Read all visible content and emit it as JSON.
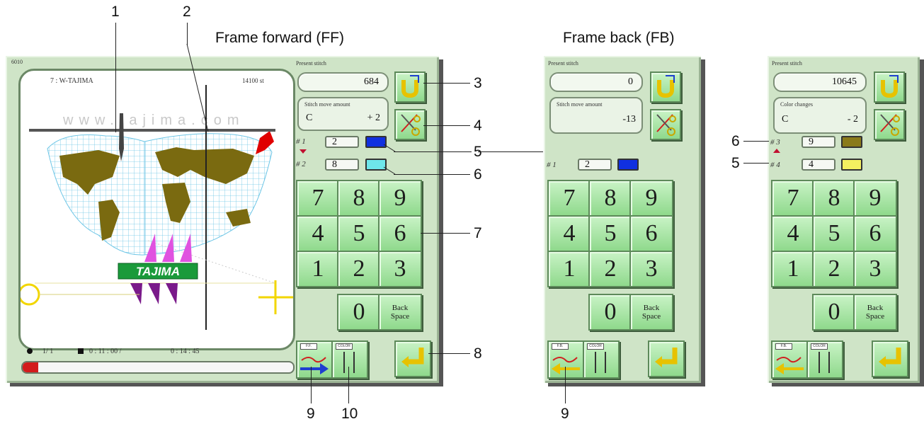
{
  "captions": {
    "frame_forward": "Frame forward (FF)",
    "frame_back": "Frame back (FB)"
  },
  "callouts": {
    "n1": "1",
    "n2": "2",
    "n3": "3",
    "n4": "4",
    "n5": "5",
    "n6": "6",
    "n7": "7",
    "n8": "8",
    "n9": "9",
    "n10": "10",
    "n5b": "5",
    "n9b": "9",
    "n6c": "6",
    "n5c": "5"
  },
  "ff_panel": {
    "corner_code": "6010",
    "design_name": "7 : W-TAJIMA",
    "design_stitches": "14100 st",
    "watermark": "www.tajima.com",
    "logo_text": "TAJIMA",
    "status": {
      "counter": "1/ 1",
      "elapsed": "0 : 11 : 00 /",
      "total": "0 : 14 : 45"
    },
    "present_stitch_label": "Present stitch",
    "present_stitch_value": "684",
    "move_label": "Stitch move amount",
    "move_mode": "C",
    "move_value": "+ 2",
    "needle_rows": [
      {
        "label": "# 1",
        "value": "2",
        "color": "#1030e0"
      },
      {
        "label": "# 2",
        "value": "8",
        "color": "#6ee6ea"
      }
    ]
  },
  "fb_panel": {
    "present_stitch_label": "Present stitch",
    "present_stitch_value": "0",
    "move_label": "Stitch move amount",
    "move_value": "-13",
    "needle_rows": [
      {
        "label": "# 1",
        "value": "2",
        "color": "#1030e0"
      }
    ]
  },
  "cb_panel": {
    "present_stitch_label": "Present stitch",
    "present_stitch_value": "10645",
    "move_label": "Color changes",
    "move_mode": "C",
    "move_value": "- 2",
    "needle_rows": [
      {
        "label": "# 3",
        "value": "9",
        "color": "#8a7a1a"
      },
      {
        "label": "# 4",
        "value": "4",
        "color": "#f4f060"
      }
    ]
  },
  "keypad": {
    "keys": [
      "7",
      "8",
      "9",
      "4",
      "5",
      "6",
      "1",
      "2",
      "3",
      "0"
    ],
    "backspace_line1": "Back",
    "backspace_line2": "Space"
  },
  "bottom_buttons": {
    "ff_tab": "F.F.",
    "fb_tab": "F.B.",
    "color_tab": "COLOR"
  },
  "colors": {
    "panel_bg": "#cfe4c7",
    "key_green": "#8fd98c",
    "ocean_grid": "#5fbfe0",
    "land": "#7a6a10",
    "accent_yellow": "#f2d600"
  }
}
